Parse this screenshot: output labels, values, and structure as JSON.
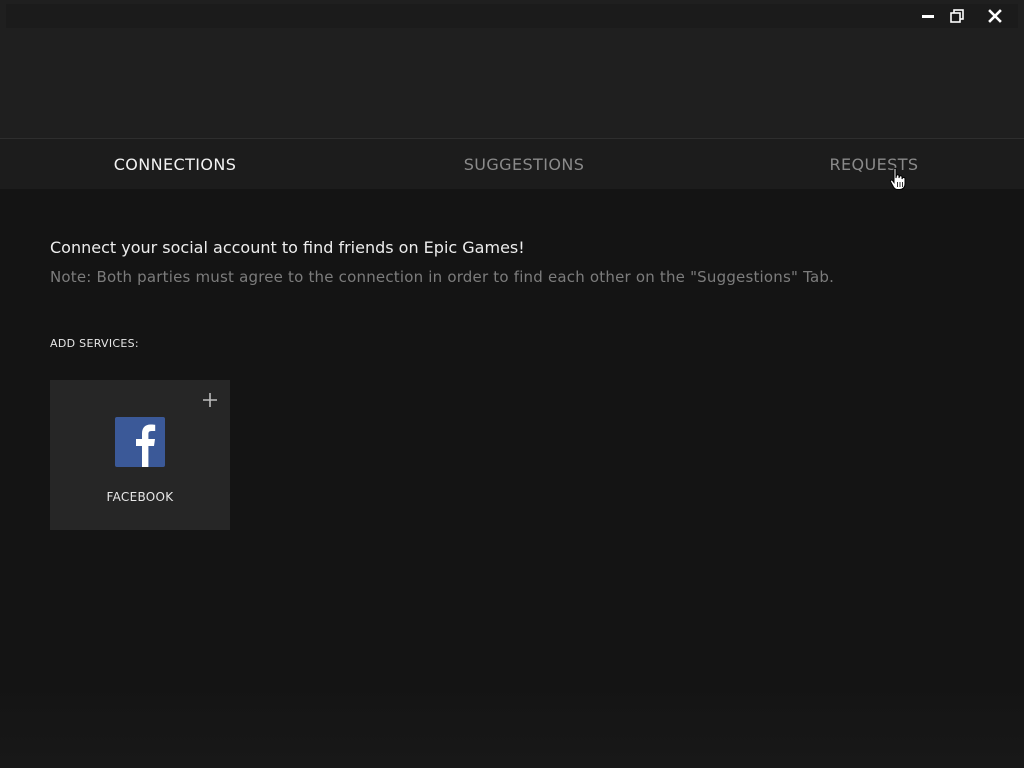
{
  "window": {
    "controls": {
      "minimize_icon": "minimize-icon",
      "restore_icon": "restore-icon",
      "close_icon": "close-icon"
    }
  },
  "tabs": [
    {
      "label": "CONNECTIONS",
      "active": true
    },
    {
      "label": "SUGGESTIONS",
      "active": false
    },
    {
      "label": "REQUESTS",
      "active": false
    }
  ],
  "content": {
    "headline": "Connect your social account to find friends on Epic Games!",
    "note": "Note: Both parties must agree to the connection in order to find each other on the \"Suggestions\" Tab.",
    "section_label": "ADD SERVICES:",
    "services": [
      {
        "name": "FACEBOOK",
        "icon": "facebook-icon",
        "action_icon": "plus-icon"
      }
    ]
  },
  "colors": {
    "background": "#121212",
    "tab_active": "#f2f2f2",
    "tab_inactive": "#8a8a8a",
    "card_background": "#262626",
    "facebook_blue": "#3b5998"
  }
}
